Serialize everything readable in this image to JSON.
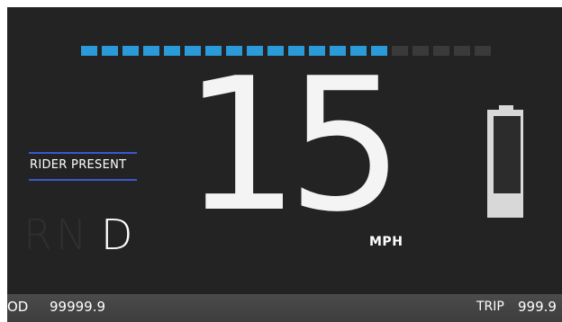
{
  "dashboard": {
    "speed": {
      "value": "15",
      "unit": "MPH",
      "bar_segments_total": 20,
      "bar_segments_active": 15,
      "active_color": "#2b9ad8",
      "inactive_color": "#3a3a3a"
    },
    "rider_status": {
      "label": "RIDER PRESENT",
      "accent_color": "#3b56d1"
    },
    "gear": {
      "options": [
        "R",
        "N",
        "D"
      ],
      "selected": "D"
    },
    "battery": {
      "icon": "battery-icon",
      "level_percent": 20
    },
    "odometer": {
      "label": "OD",
      "value": "99999.9"
    },
    "trip": {
      "label": "TRIP",
      "value": "999.9"
    }
  }
}
